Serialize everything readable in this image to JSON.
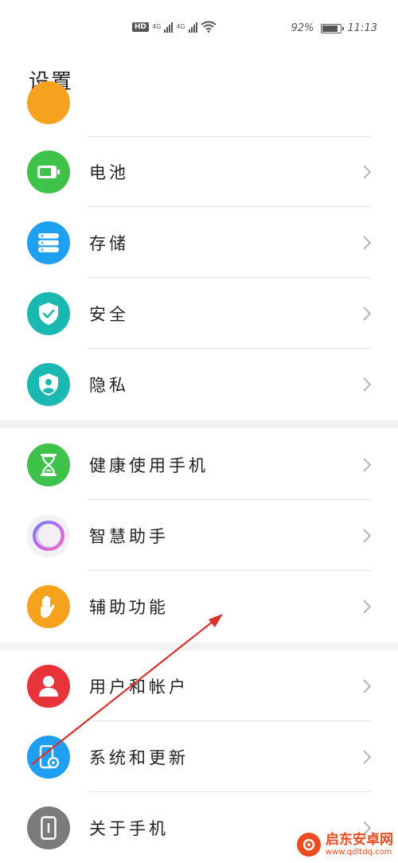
{
  "status_bar": {
    "hd": "HD",
    "net1": "4G",
    "net2": "4G",
    "battery_text": "92%",
    "battery_level": 0.92,
    "time": "11:13"
  },
  "page_title": "设置",
  "groups": [
    {
      "items": [
        {
          "label": "电池",
          "icon": "battery-icon",
          "color": "#3ec24b"
        },
        {
          "label": "存储",
          "icon": "storage-icon",
          "color": "#1e9ff2"
        },
        {
          "label": "安全",
          "icon": "shield-check-icon",
          "color": "#1ab8b0"
        },
        {
          "label": "隐私",
          "icon": "privacy-icon",
          "color": "#1ab8b0"
        }
      ]
    },
    {
      "items": [
        {
          "label": "健康使用手机",
          "icon": "hourglass-icon",
          "color": "#3ec24b"
        },
        {
          "label": "智慧助手",
          "icon": "assistant-ring-icon",
          "color": "#ffffff"
        },
        {
          "label": "辅助功能",
          "icon": "hand-icon",
          "color": "#f7a21e"
        }
      ]
    },
    {
      "items": [
        {
          "label": "用户和帐户",
          "icon": "user-icon",
          "color": "#e8333b"
        },
        {
          "label": "系统和更新",
          "icon": "system-update-icon",
          "color": "#1e9ff2"
        },
        {
          "label": "关于手机",
          "icon": "phone-info-icon",
          "color": "#7b7b7b"
        }
      ]
    }
  ],
  "watermark": {
    "title": "启东安卓网",
    "url": "www.qdltdq.com"
  },
  "annotation_arrow_color": "#d8302a"
}
